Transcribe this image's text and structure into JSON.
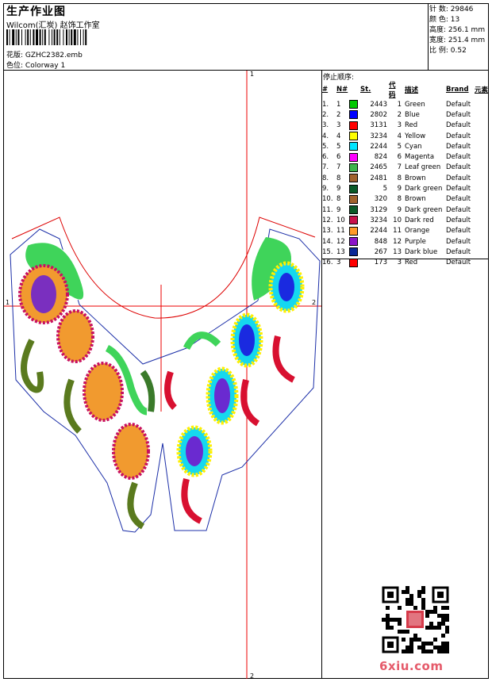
{
  "header": {
    "title": "生产作业图",
    "company": "Wilcom(汇炭) 赵饰工作室",
    "file_label": "花版:",
    "file_value": "GZHC2382.emb",
    "color_label": "色位:",
    "color_value": "Colorway 1"
  },
  "stats": [
    {
      "label": "针 数:",
      "value": "29846"
    },
    {
      "label": "颜 色:",
      "value": "13"
    },
    {
      "label": "高度:",
      "value": "256.1 mm"
    },
    {
      "label": "宽度:",
      "value": "251.4 mm"
    },
    {
      "label": "比 例:",
      "value": "0.52"
    }
  ],
  "sequence": {
    "title": "停止顺序:",
    "headers": [
      "#",
      "N#",
      "St.",
      "代码",
      "描述",
      "Brand",
      "元素"
    ],
    "rows": [
      {
        "idx": "1.",
        "n": "1",
        "color": "#00c800",
        "st": "2443",
        "code": "1",
        "desc": "Green",
        "brand": "Default"
      },
      {
        "idx": "2.",
        "n": "2",
        "color": "#0000ff",
        "st": "2802",
        "code": "2",
        "desc": "Blue",
        "brand": "Default"
      },
      {
        "idx": "3.",
        "n": "3",
        "color": "#ff0000",
        "st": "3131",
        "code": "3",
        "desc": "Red",
        "brand": "Default"
      },
      {
        "idx": "4.",
        "n": "4",
        "color": "#ffff00",
        "st": "3234",
        "code": "4",
        "desc": "Yellow",
        "brand": "Default"
      },
      {
        "idx": "5.",
        "n": "5",
        "color": "#00e5ff",
        "st": "2244",
        "code": "5",
        "desc": "Cyan",
        "brand": "Default"
      },
      {
        "idx": "6.",
        "n": "6",
        "color": "#ff00ff",
        "st": "824",
        "code": "6",
        "desc": "Magenta",
        "brand": "Default"
      },
      {
        "idx": "7.",
        "n": "7",
        "color": "#3cb44b",
        "st": "2465",
        "code": "7",
        "desc": "Leaf green",
        "brand": "Default"
      },
      {
        "idx": "8.",
        "n": "8",
        "color": "#a0622d",
        "st": "2481",
        "code": "8",
        "desc": "Brown",
        "brand": "Default"
      },
      {
        "idx": "9.",
        "n": "9",
        "color": "#0a5a28",
        "st": "5",
        "code": "9",
        "desc": "Dark green",
        "brand": "Default"
      },
      {
        "idx": "10.",
        "n": "8",
        "color": "#a0622d",
        "st": "320",
        "code": "8",
        "desc": "Brown",
        "brand": "Default"
      },
      {
        "idx": "11.",
        "n": "9",
        "color": "#0a5a28",
        "st": "3129",
        "code": "9",
        "desc": "Dark green",
        "brand": "Default"
      },
      {
        "idx": "12.",
        "n": "10",
        "color": "#c8104a",
        "st": "3234",
        "code": "10",
        "desc": "Dark red",
        "brand": "Default"
      },
      {
        "idx": "13.",
        "n": "11",
        "color": "#ff9a28",
        "st": "2244",
        "code": "11",
        "desc": "Orange",
        "brand": "Default"
      },
      {
        "idx": "14.",
        "n": "12",
        "color": "#8a14c8",
        "st": "848",
        "code": "12",
        "desc": "Purple",
        "brand": "Default"
      },
      {
        "idx": "15.",
        "n": "13",
        "color": "#0a2896",
        "st": "267",
        "code": "13",
        "desc": "Dark blue",
        "brand": "Default"
      },
      {
        "idx": "16.",
        "n": "3",
        "color": "#ff0000",
        "st": "173",
        "code": "3",
        "desc": "Red",
        "brand": "Default"
      }
    ]
  },
  "markers": {
    "top": "1",
    "bottom": "2",
    "left": "1",
    "right": "2"
  },
  "watermark": "6xiu.com"
}
